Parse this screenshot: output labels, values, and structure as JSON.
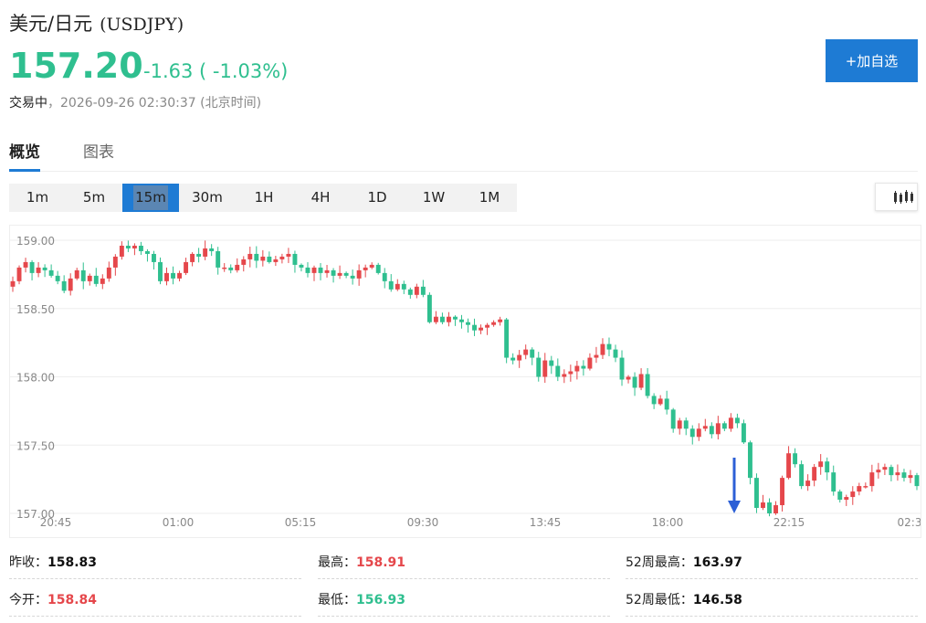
{
  "header": {
    "title": "美元/日元",
    "code": "(USDJPY)",
    "price": "157.20",
    "change": "-1.63 ( -1.03%)",
    "status_label": "交易中",
    "status_time": "，2026-09-26 02:30:37 (北京时间)",
    "add_button": "+加自选"
  },
  "tabs": [
    {
      "label": "概览",
      "active": true
    },
    {
      "label": "图表",
      "active": false
    }
  ],
  "intervals": [
    {
      "label": "1m"
    },
    {
      "label": "5m"
    },
    {
      "label": "15m",
      "active": true
    },
    {
      "label": "30m"
    },
    {
      "label": "1H"
    },
    {
      "label": "4H"
    },
    {
      "label": "1D"
    },
    {
      "label": "1W"
    },
    {
      "label": "1M"
    }
  ],
  "toolbar": {
    "candle_icon": "candlestick-icon"
  },
  "colors": {
    "up": "#e5474b",
    "down": "#2fbf8f",
    "accent": "#1e7bd4",
    "marker": "#2c5fd6"
  },
  "chart_data": {
    "type": "candlestick",
    "y_ticks": [
      "159.00",
      "158.50",
      "158.00",
      "157.50",
      "157.00"
    ],
    "ylim": [
      157.0,
      159.1
    ],
    "x_ticks": [
      "20:45",
      "01:00",
      "05:15",
      "09:30",
      "13:45",
      "18:00",
      "22:15",
      "02:3"
    ],
    "grid": true,
    "marker": {
      "type": "down-arrow",
      "near_x_label": "18:00",
      "value": 157.0
    },
    "close": [
      158.7,
      158.8,
      158.84,
      158.76,
      158.8,
      158.78,
      158.74,
      158.7,
      158.63,
      158.72,
      158.78,
      158.7,
      158.74,
      158.68,
      158.72,
      158.8,
      158.88,
      158.96,
      158.94,
      158.96,
      158.92,
      158.9,
      158.84,
      158.7,
      158.76,
      158.72,
      158.76,
      158.84,
      158.9,
      158.88,
      158.94,
      158.92,
      158.8,
      158.8,
      158.78,
      158.82,
      158.86,
      158.9,
      158.85,
      158.88,
      158.84,
      158.86,
      158.88,
      158.9,
      158.82,
      158.8,
      158.76,
      158.8,
      158.76,
      158.78,
      158.74,
      158.76,
      158.74,
      158.72,
      158.78,
      158.8,
      158.82,
      158.76,
      158.7,
      158.64,
      158.68,
      158.64,
      158.6,
      158.66,
      158.6,
      158.4,
      158.44,
      158.4,
      158.44,
      158.42,
      158.4,
      158.38,
      158.34,
      158.36,
      158.38,
      158.4,
      158.42,
      158.14,
      158.12,
      158.16,
      158.2,
      158.14,
      158.0,
      158.12,
      158.08,
      158.0,
      158.02,
      158.04,
      158.08,
      158.06,
      158.14,
      158.16,
      158.24,
      158.2,
      158.14,
      157.98,
      158.0,
      157.92,
      158.02,
      157.86,
      157.8,
      157.84,
      157.76,
      157.62,
      157.68,
      157.62,
      157.56,
      157.62,
      157.64,
      157.58,
      157.66,
      157.62,
      157.7,
      157.66,
      157.52,
      157.26,
      157.04,
      157.08,
      157.0,
      157.06,
      157.26,
      157.44,
      157.36,
      157.2,
      157.24,
      157.34,
      157.38,
      157.3,
      157.16,
      157.1,
      157.12,
      157.16,
      157.2,
      157.2,
      157.3,
      157.32,
      157.34,
      157.28,
      157.3,
      157.26,
      157.28,
      157.2
    ]
  },
  "stats": [
    {
      "label": "昨收：",
      "value": "158.83",
      "tone": "dark"
    },
    {
      "label": "最高：",
      "value": "158.91",
      "tone": "red"
    },
    {
      "label": "52周最高：",
      "value": "163.97",
      "tone": "dark"
    },
    {
      "label": "今开：",
      "value": "158.84",
      "tone": "red"
    },
    {
      "label": "最低：",
      "value": "156.93",
      "tone": "green"
    },
    {
      "label": "52周最低：",
      "value": "146.58",
      "tone": "dark"
    }
  ]
}
